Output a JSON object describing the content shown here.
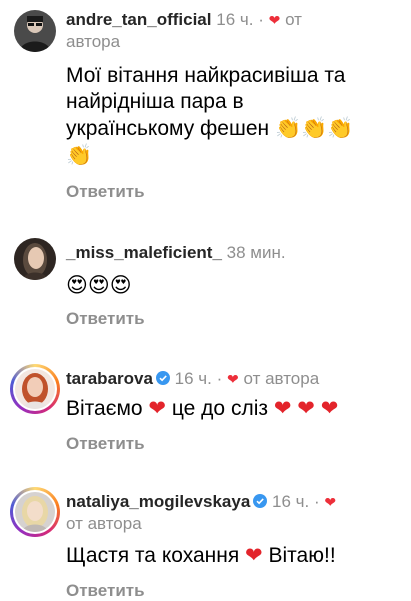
{
  "comments": [
    {
      "username": "andre_tan_official",
      "time": "16 ч.",
      "sep": "·",
      "from_author": "от",
      "from_author2": "автора",
      "text_line1": "Мої вітання найкрасивіша та",
      "text_line2": "найрідніша пара в",
      "text_line3": "українському фешен",
      "emoji_clap": "👏👏👏",
      "emoji_clap2": "👏",
      "reply": "Ответить",
      "avatar_icon": "user-avatar-dark"
    },
    {
      "username": "_miss_maleficient_",
      "time": "38 мин.",
      "emoji": "😍😍😍",
      "reply": "Ответить",
      "avatar_icon": "user-avatar-woman"
    },
    {
      "username": "tarabarova",
      "time": "16 ч.",
      "sep": "·",
      "from_author": "от автора",
      "text": "Вітаємо",
      "text_mid": "це до сліз",
      "reply": "Ответить",
      "avatar_icon": "user-avatar-redhead",
      "verified": true
    },
    {
      "username": "nataliya_mogilevskaya",
      "time": "16 ч.",
      "sep": "·",
      "from_author": "от автора",
      "text": "Щастя та кохання",
      "text_end": "Вітаю!!",
      "reply": "Ответить",
      "avatar_icon": "user-avatar-blonde",
      "verified": true
    }
  ],
  "colors": {
    "heart": "#ed2f3a",
    "verified": "#3897f0",
    "muted": "#8e8e8e"
  }
}
